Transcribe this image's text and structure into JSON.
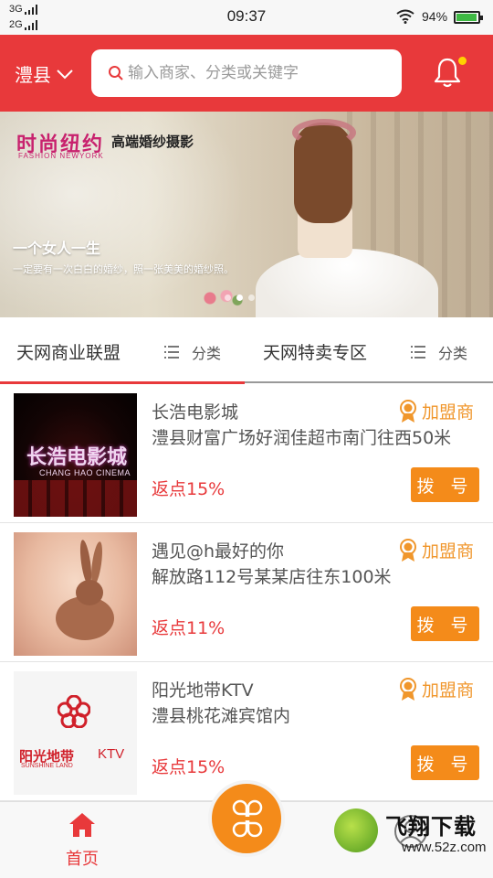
{
  "status_bar": {
    "network1": "3G",
    "network2": "2G",
    "time": "09:37",
    "battery_pct": "94%",
    "battery_level": 0.94,
    "icons": [
      "signal-icon",
      "wifi-icon",
      "battery-icon"
    ]
  },
  "header": {
    "city": "澧县",
    "search_placeholder": "输入商家、分类或关键字",
    "icons": [
      "chevron-down-icon",
      "search-icon",
      "bell-icon"
    ],
    "colors": {
      "header_bg": "#e8393b",
      "notify_dot": "#ffd200"
    }
  },
  "banner": {
    "brand_title": "时尚纽约",
    "brand_sub": "高端婚纱摄影",
    "brand_en": "FASHION  NEWYORK",
    "tagline": "一个女人一生",
    "tagline_sub": "一定要有一次白白的婚纱，照一张美美的婚纱照。",
    "slide_count": 3,
    "active_slide": 2
  },
  "tabs": {
    "items": [
      {
        "label": "天网商业联盟",
        "active": true
      },
      {
        "label": "分类",
        "icon": "list-icon"
      },
      {
        "label": "天网特卖专区"
      },
      {
        "label": "分类",
        "icon": "list-icon"
      }
    ]
  },
  "listings": [
    {
      "name": "长浩电影城",
      "address": "澧县财富广场好润佳超市南门往西50米",
      "rebate": "返点15%",
      "badge": "加盟商",
      "dial_label": "拨 号",
      "thumb_text": "长浩电影城",
      "thumb_en": "CHANG HAO CINEMA"
    },
    {
      "name": "遇见@h最好的你",
      "address": "解放路112号某某店往东100米",
      "rebate": "返点11%",
      "badge": "加盟商",
      "dial_label": "拨 号"
    },
    {
      "name": "阳光地带KTV",
      "address": "澧县桃花滩宾馆内",
      "rebate": "返点15%",
      "badge": "加盟商",
      "dial_label": "拨 号",
      "thumb_text": "阳光地带",
      "thumb_ktv": "KTV",
      "thumb_en": "SUNSHINE LAND"
    }
  ],
  "bottom_nav": {
    "home_label": "首页",
    "icons": [
      "home-icon",
      "apps-icon",
      "user-icon"
    ],
    "colors": {
      "accent": "#f48b1a",
      "active": "#e8393b"
    }
  },
  "watermark": {
    "cn": "飞翔下载",
    "url": "www.52z.com"
  }
}
